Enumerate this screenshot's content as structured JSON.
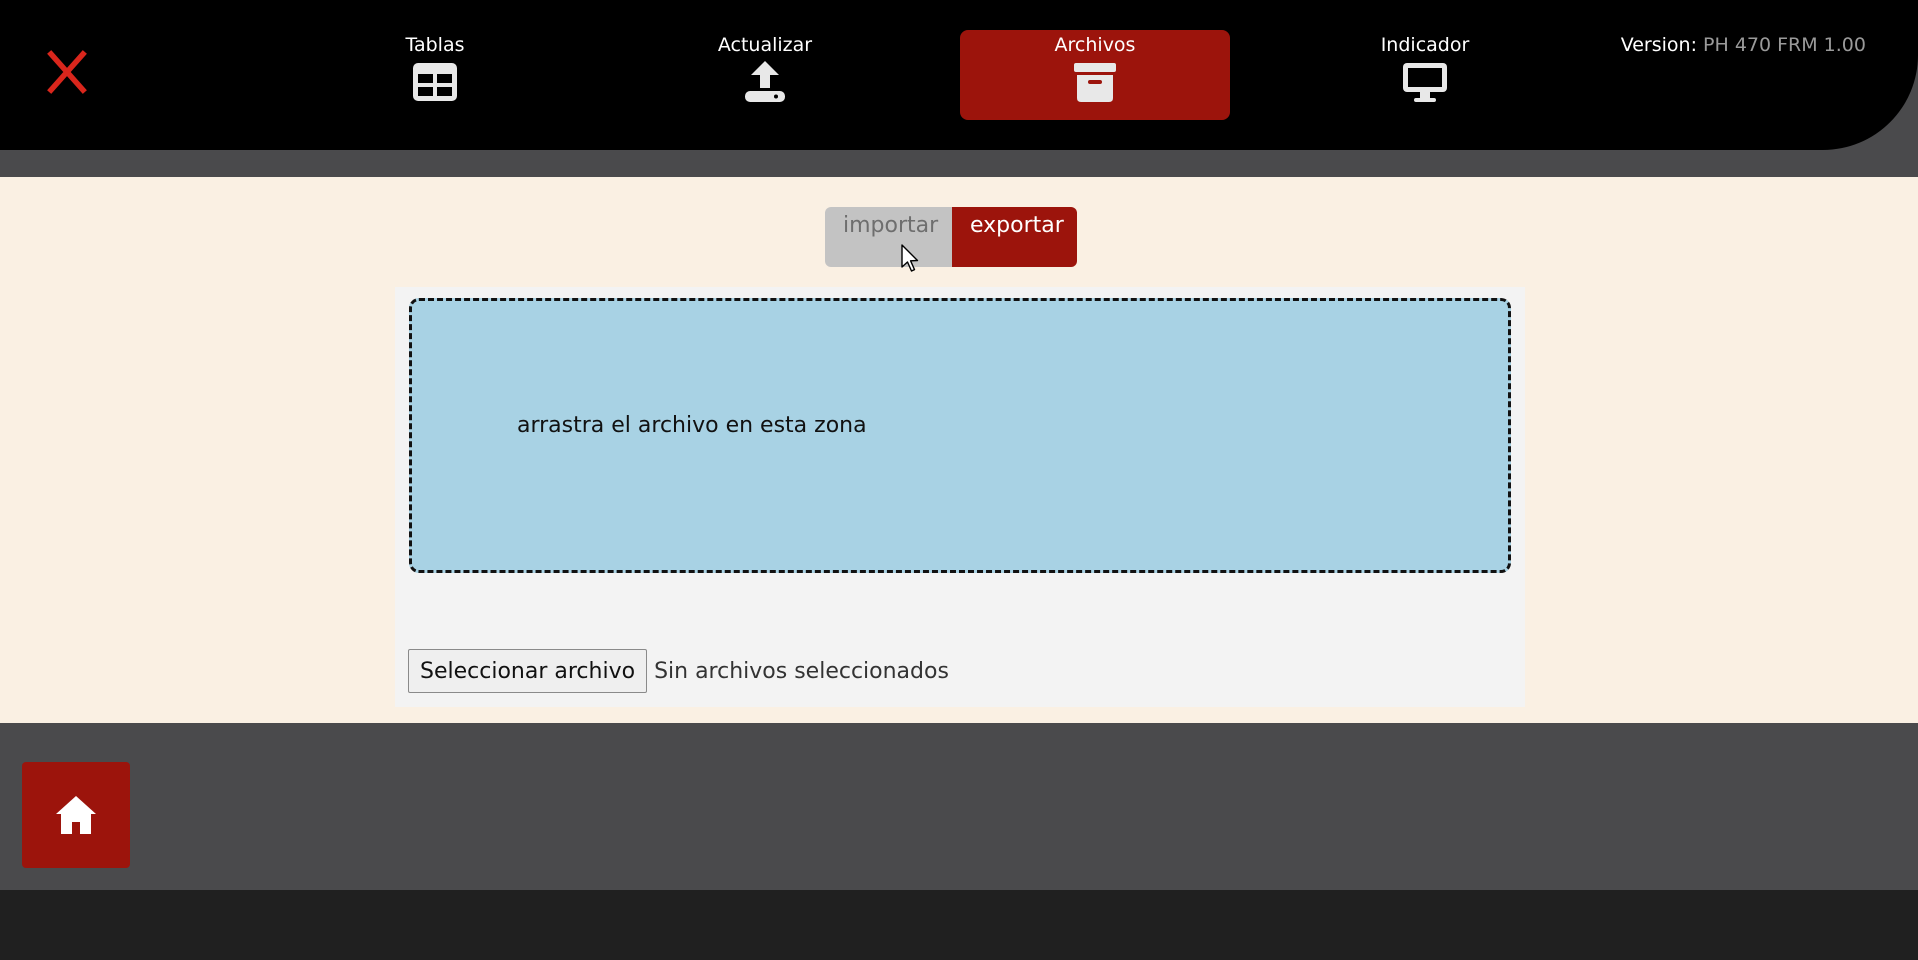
{
  "nav": {
    "close_icon": "close-x-icon",
    "items": [
      {
        "label": "Tablas",
        "icon": "table-grid-icon",
        "active": false
      },
      {
        "label": "Actualizar",
        "icon": "upload-tray-icon",
        "active": false
      },
      {
        "label": "Archivos",
        "icon": "archive-box-icon",
        "active": true
      },
      {
        "label": "Indicador",
        "icon": "monitor-icon",
        "active": false
      }
    ],
    "version_label": "Version:",
    "version_value": "PH 470 FRM 1.00"
  },
  "toggle": {
    "importar": "importar",
    "exportar": "exportar",
    "active": "exportar"
  },
  "dropzone": {
    "text": "arrastra el archivo en esta zona"
  },
  "file_input": {
    "button_label": "Seleccionar archivo",
    "status": "Sin archivos seleccionados"
  },
  "home": {
    "icon": "home-icon"
  },
  "colors": {
    "topbar": "#000000",
    "accent_red": "#9c140c",
    "close_red": "#d9261c",
    "content_bg": "#faf0e3",
    "dropzone_bg": "#a8d2e4",
    "gray_bg": "#4a4a4c",
    "footer_bg": "#202020"
  }
}
